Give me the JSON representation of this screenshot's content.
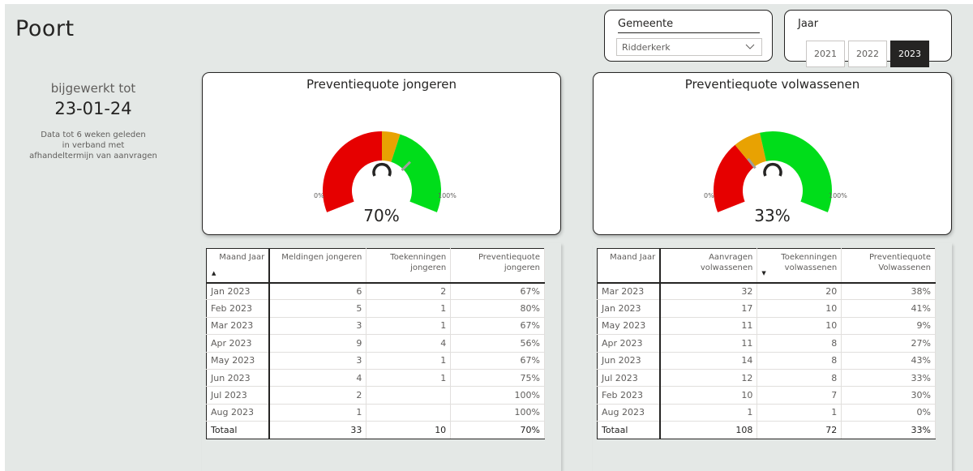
{
  "page": {
    "title": "Poort"
  },
  "updated": {
    "label": "bijgewerkt tot",
    "date": "23-01-24",
    "note_line1": "Data tot 6 weken geleden",
    "note_line2": "in verband met",
    "note_line3": "afhandeltermijn van aanvragen"
  },
  "slicers": {
    "gemeente": {
      "label": "Gemeente",
      "selected": "Ridderkerk"
    },
    "jaar": {
      "label": "Jaar",
      "options": [
        "2021",
        "2022",
        "2023"
      ],
      "selected": "2023"
    }
  },
  "gauges": [
    {
      "title": "Preventiequote jongeren",
      "value": 0.7,
      "value_label": "70%",
      "min_label": "0%",
      "max_label": "100%"
    },
    {
      "title": "Preventiequote volwassenen",
      "value": 0.33,
      "value_label": "33%",
      "min_label": "0%",
      "max_label": "100%"
    }
  ],
  "colors": {
    "red": "#e60000",
    "orange": "#e8a202",
    "green": "#00dd1a",
    "needle": "#a19f9d",
    "selected": "#252423"
  },
  "table_jongeren": {
    "headers": [
      "Maand Jaar",
      "Meldingen jongeren",
      "Toekenningen jongeren",
      "Preventiequote jongeren"
    ],
    "rows": [
      [
        "Jan 2023",
        "6",
        "2",
        "67%"
      ],
      [
        "Feb 2023",
        "5",
        "1",
        "80%"
      ],
      [
        "Mar 2023",
        "3",
        "1",
        "67%"
      ],
      [
        "Apr 2023",
        "9",
        "4",
        "56%"
      ],
      [
        "May 2023",
        "3",
        "1",
        "67%"
      ],
      [
        "Jun 2023",
        "4",
        "1",
        "75%"
      ],
      [
        "Jul 2023",
        "2",
        "",
        "100%"
      ],
      [
        "Aug 2023",
        "1",
        "",
        "100%"
      ]
    ],
    "total": [
      "Totaal",
      "33",
      "10",
      "70%"
    ]
  },
  "table_volwassenen": {
    "headers": [
      "Maand Jaar",
      "Aanvragen volwassenen",
      "Toekenningen volwassenen",
      "Preventiequote Volwassenen"
    ],
    "rows": [
      [
        "Mar 2023",
        "32",
        "20",
        "38%"
      ],
      [
        "Jan 2023",
        "17",
        "10",
        "41%"
      ],
      [
        "May 2023",
        "11",
        "10",
        "9%"
      ],
      [
        "Apr 2023",
        "11",
        "8",
        "27%"
      ],
      [
        "Jun 2023",
        "14",
        "8",
        "43%"
      ],
      [
        "Jul 2023",
        "12",
        "8",
        "33%"
      ],
      [
        "Feb 2023",
        "10",
        "7",
        "30%"
      ],
      [
        "Aug 2023",
        "1",
        "1",
        "0%"
      ]
    ],
    "total": [
      "Totaal",
      "108",
      "72",
      "33%"
    ]
  }
}
